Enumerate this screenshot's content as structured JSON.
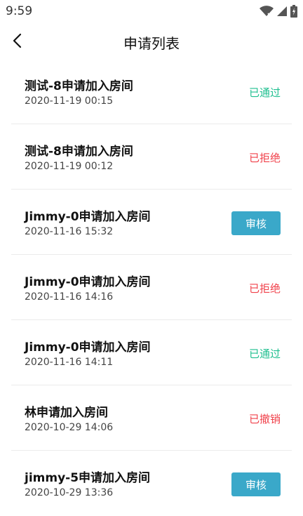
{
  "status_bar": {
    "time": "9:59",
    "icons": [
      "wifi-icon",
      "signal-icon",
      "battery-icon"
    ]
  },
  "header": {
    "title": "申请列表",
    "back_icon": "chevron-left-icon"
  },
  "colors": {
    "approved": "#1fbf8f",
    "rejected": "#f0404a",
    "review_button": "#3aa8c9"
  },
  "requests": [
    {
      "title": "测试-8申请加入房间",
      "date": "2020-11-19 00:15",
      "status": "已通过",
      "type": "approved"
    },
    {
      "title": "测试-8申请加入房间",
      "date": "2020-11-19 00:12",
      "status": "已拒绝",
      "type": "rejected"
    },
    {
      "title": "Jimmy-0申请加入房间",
      "date": "2020-11-16 15:32",
      "status": "审核",
      "type": "review"
    },
    {
      "title": "Jimmy-0申请加入房间",
      "date": "2020-11-16 14:16",
      "status": "已拒绝",
      "type": "rejected"
    },
    {
      "title": "Jimmy-0申请加入房间",
      "date": "2020-11-16 14:11",
      "status": "已通过",
      "type": "approved"
    },
    {
      "title": "林申请加入房间",
      "date": "2020-10-29 14:06",
      "status": "已撤销",
      "type": "revoked"
    },
    {
      "title": "jimmy-5申请加入房间",
      "date": "2020-10-29 13:36",
      "status": "审核",
      "type": "review"
    }
  ]
}
